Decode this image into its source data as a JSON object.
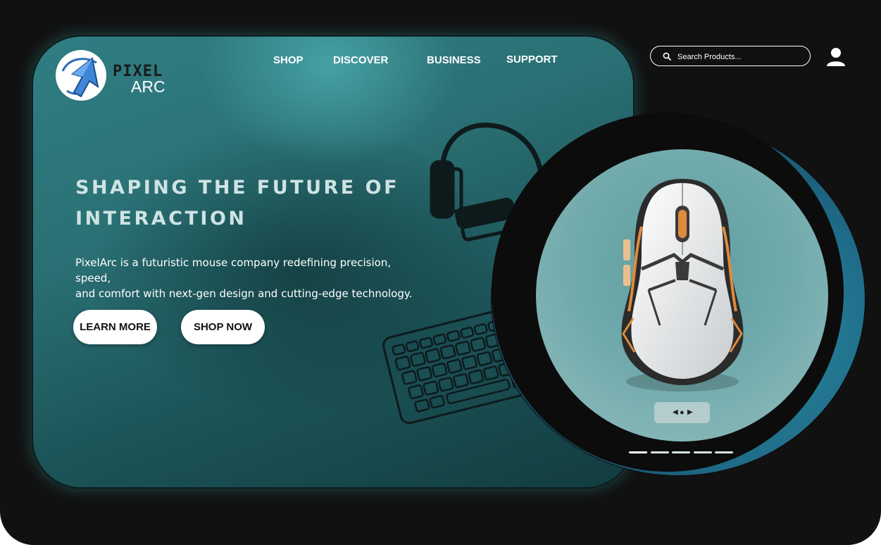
{
  "brand": {
    "word1": "PIXEL",
    "word2": "ARC"
  },
  "nav": {
    "shop": "SHOP",
    "discover": "DISCOVER",
    "business": "BUSINESS",
    "support": "SUPPORT"
  },
  "search": {
    "placeholder": "Search Products..."
  },
  "hero": {
    "headline_line1": "SHAPING THE FUTURE OF",
    "headline_line2": "INTERACTION",
    "description_line1": "PixelArc is a futuristic mouse company redefining precision, speed,",
    "description_line2": "and comfort with next-gen design and cutting-edge technology.",
    "learn_more": "LEARN MORE",
    "shop_now": "SHOP NOW"
  },
  "carousel": {
    "slide_count": 5,
    "active_slide": 1
  },
  "colors": {
    "background": "#111111",
    "hero_teal": "#2a7074",
    "accent_orange": "#e08a3c",
    "ring_blue": "#1f6a88"
  },
  "icons": [
    "logo-arrow-icon",
    "search-icon",
    "user-icon",
    "headphones-icon",
    "keyboard-icon",
    "chevron-left-icon",
    "chevron-right-icon"
  ]
}
